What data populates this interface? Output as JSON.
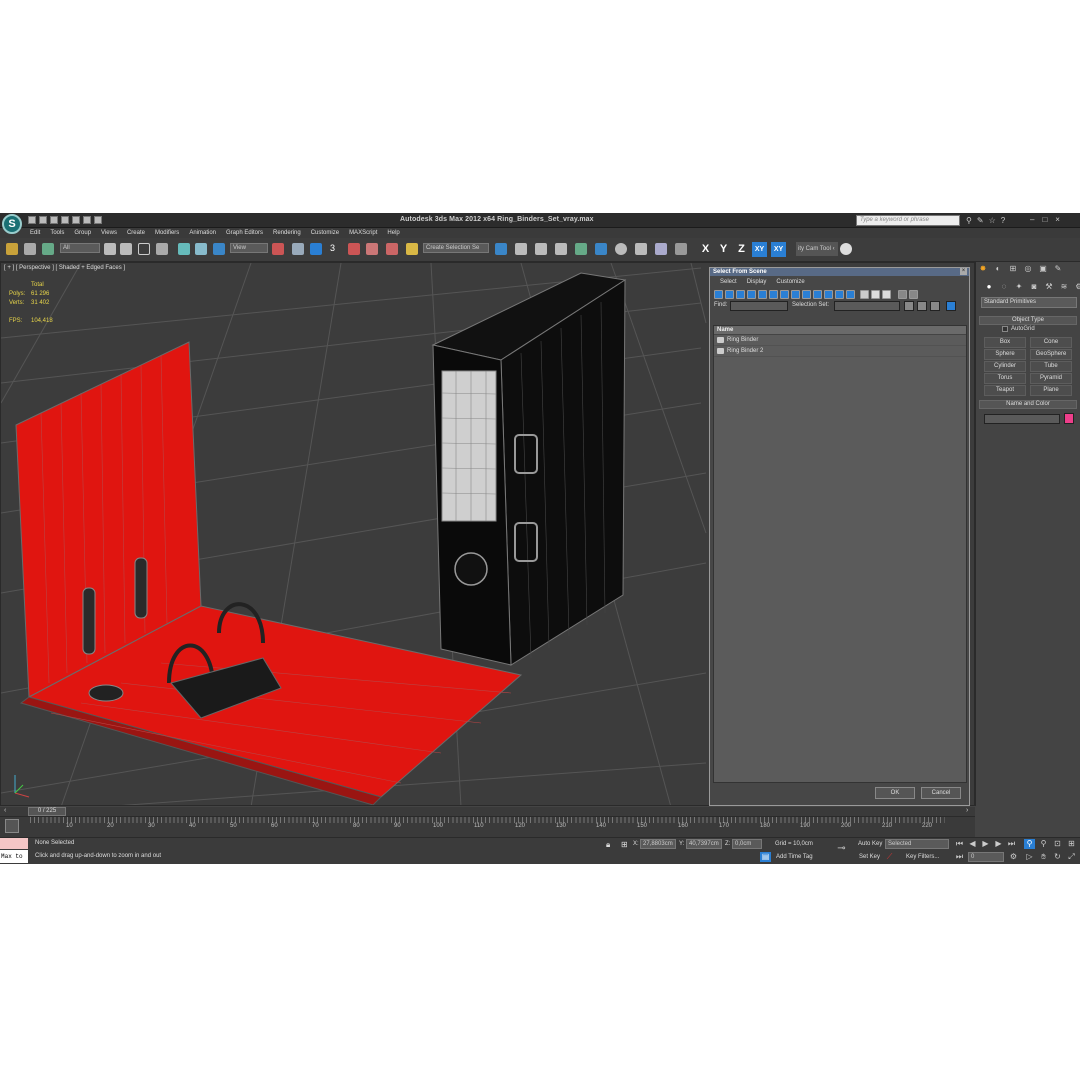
{
  "titlebar": {
    "logo": "S",
    "title": "Autodesk 3ds Max  2012 x64     Ring_Binders_Set_vray.max",
    "search_placeholder": "Type a keyword or phrase"
  },
  "menu": [
    "Edit",
    "Tools",
    "Group",
    "Views",
    "Create",
    "Modifiers",
    "Animation",
    "Graph Editors",
    "Rendering",
    "Customize",
    "MAXScript",
    "Help"
  ],
  "toolbar": {
    "filter": "All",
    "refcoord": "View",
    "snap_label": "3",
    "selection_set": "Create Selection Se",
    "axis_x": "X",
    "axis_y": "Y",
    "axis_z": "Z",
    "axis_xy": "XY",
    "axis_xy2": "XY",
    "cam_tool": "ity Cam Tool ‹"
  },
  "viewport": {
    "label": "[ + ] [ Perspective ] [ Shaded + Edged Faces ]",
    "stats_header": "Total",
    "polys_label": "Polys:",
    "polys_value": "61 296",
    "verts_label": "Verts:",
    "verts_value": "31 402",
    "fps_label": "FPS:",
    "fps_value": "104,418"
  },
  "dialog": {
    "title": "Select From Scene",
    "menu": [
      "Select",
      "Display",
      "Customize"
    ],
    "find_label": "Find:",
    "selection_set_label": "Selection Set:",
    "column_name": "Name",
    "items": [
      "Ring Binder",
      "Ring Binder 2"
    ],
    "ok": "OK",
    "cancel": "Cancel"
  },
  "command_panel": {
    "dropdown": "Standard Primitives",
    "object_type": "Object Type",
    "autogrid": "AutoGrid",
    "primitives": [
      "Box",
      "Cone",
      "Sphere",
      "GeoSphere",
      "Cylinder",
      "Tube",
      "Torus",
      "Pyramid",
      "Teapot",
      "Plane"
    ],
    "name_and_color": "Name and Color",
    "color": "#ee3e8a"
  },
  "timeline": {
    "slider": "0 / 225",
    "ticks": [
      "10",
      "20",
      "30",
      "40",
      "50",
      "60",
      "70",
      "80",
      "90",
      "100",
      "110",
      "120",
      "130",
      "140",
      "150",
      "160",
      "170",
      "180",
      "190",
      "200",
      "210",
      "220"
    ]
  },
  "status": {
    "maxscript": "Max to",
    "selection": "None Selected",
    "prompt": "Click and drag up-and-down to zoom in and out",
    "x_label": "X:",
    "x_value": "27,8803cm",
    "y_label": "Y:",
    "y_value": "40,7397cm",
    "z_label": "Z:",
    "z_value": "0,0cm",
    "grid": "Grid = 10,0cm",
    "add_time_tag": "Add Time Tag",
    "auto_key": "Auto Key",
    "selected": "Selected",
    "set_key": "Set Key",
    "key_filters": "Key Filters...",
    "frame": "0"
  },
  "colors": {
    "binder_red": "#e01510",
    "binder_black": "#0d0d0d",
    "accent_blue": "#2a7fd4",
    "dialog_title": "#586a86"
  }
}
